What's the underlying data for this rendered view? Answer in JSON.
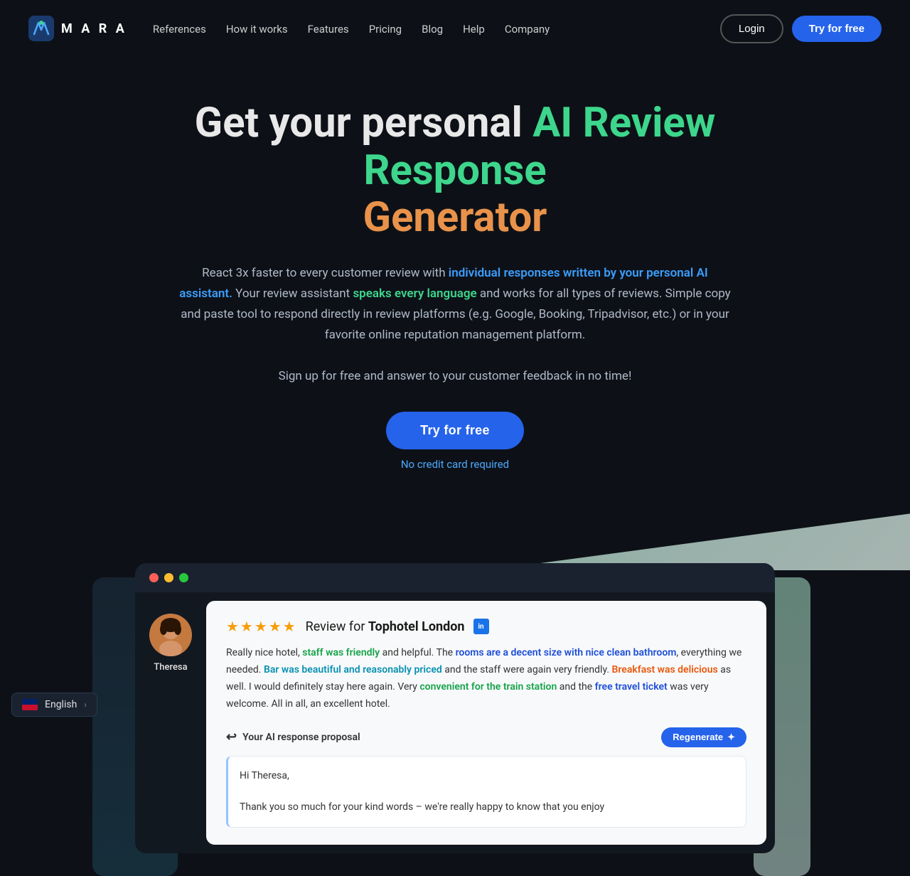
{
  "nav": {
    "logo_text": "M A R A",
    "links": [
      {
        "label": "References",
        "href": "#"
      },
      {
        "label": "How it works",
        "href": "#"
      },
      {
        "label": "Features",
        "href": "#"
      },
      {
        "label": "Pricing",
        "href": "#"
      },
      {
        "label": "Blog",
        "href": "#"
      },
      {
        "label": "Help",
        "href": "#"
      },
      {
        "label": "Company",
        "href": "#"
      }
    ],
    "login_label": "Login",
    "try_label": "Try for free"
  },
  "hero": {
    "headline_prefix": "Get your personal ",
    "headline_highlight": "AI Review Response",
    "headline_suffix": " ",
    "headline_generator": "Generator",
    "desc_part1": "React 3x faster to every customer review with ",
    "desc_highlight1": "individual responses written by your personal AI assistant.",
    "desc_part2": " Your review assistant ",
    "desc_highlight2": "speaks every language",
    "desc_part3": " and works for all types of reviews. Simple copy and paste tool to respond directly in review platforms (e.g. Google, Booking, Tripadvisor, etc.) or in your favorite online reputation management platform.",
    "desc_signup": "Sign up for free and answer to your customer feedback in no time!",
    "cta_label": "Try for free",
    "no_credit": "No credit card required"
  },
  "demo": {
    "titlebar_dots": [
      "red",
      "yellow",
      "green"
    ],
    "reviewer_name": "Theresa",
    "stars": "★★★★★",
    "review_for_prefix": "Review for ",
    "hotel_name": "Tophotel London",
    "review_text_parts": [
      {
        "text": "Really nice hotel, ",
        "type": "normal"
      },
      {
        "text": "staff was friendly",
        "type": "green"
      },
      {
        "text": " and helpful. The ",
        "type": "normal"
      },
      {
        "text": "rooms are a decent size with nice clean bathroom",
        "type": "blue"
      },
      {
        "text": ", everything we needed.  ",
        "type": "normal"
      },
      {
        "text": "Bar was beautiful and reasonably priced",
        "type": "teal"
      },
      {
        "text": " and the staff were again very friendly. ",
        "type": "normal"
      },
      {
        "text": "Breakfast was delicious",
        "type": "orange"
      },
      {
        "text": " as well. I would definitely stay here again. Very ",
        "type": "normal"
      },
      {
        "text": "convenient for the train station",
        "type": "green"
      },
      {
        "text": " and the ",
        "type": "normal"
      },
      {
        "text": "free travel ticket",
        "type": "blue"
      },
      {
        "text": " was very welcome. All in all, an excellent hotel.",
        "type": "normal"
      }
    ],
    "ai_response_label": "Your AI response proposal",
    "regenerate_label": "Regenerate",
    "ai_response_text_line1": "Hi Theresa,",
    "ai_response_text_line2": "Thank you so much for your kind words – we're really happy to know that you enjoy"
  },
  "footer": {
    "lang_label": "English",
    "lang_arrow": "›"
  }
}
